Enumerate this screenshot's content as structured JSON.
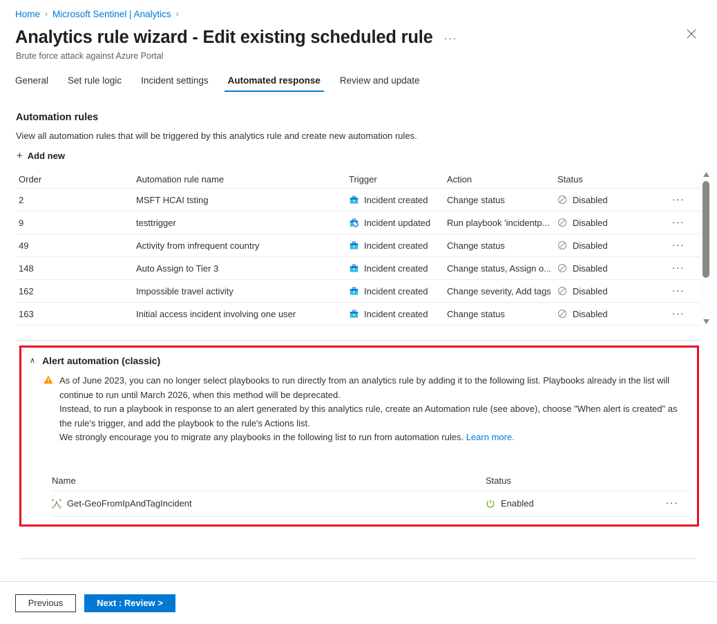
{
  "breadcrumb": {
    "items": [
      {
        "label": "Home"
      },
      {
        "label": "Microsoft Sentinel | Analytics"
      }
    ],
    "separator": "›"
  },
  "header": {
    "title": "Analytics rule wizard - Edit existing scheduled rule",
    "ellipsis": "···",
    "subtitle": "Brute force attack against Azure Portal",
    "close_label": "Close"
  },
  "tabs": [
    {
      "label": "General",
      "active": false
    },
    {
      "label": "Set rule logic",
      "active": false
    },
    {
      "label": "Incident settings",
      "active": false
    },
    {
      "label": "Automated response",
      "active": true
    },
    {
      "label": "Review and update",
      "active": false
    }
  ],
  "automation": {
    "section_title": "Automation rules",
    "section_desc": "View all automation rules that will be triggered by this analytics rule and create new automation rules.",
    "add_new_label": "Add new",
    "add_new_plus": "+",
    "columns": [
      "Order",
      "Automation rule name",
      "Trigger",
      "Action",
      "Status"
    ],
    "rows": [
      {
        "order": "2",
        "name": "MSFT HCAI tsting",
        "trigger": "Incident created",
        "trigger_icon": "incident-created-icon",
        "action": "Change status",
        "status": "Disabled",
        "status_icon": "disabled-icon",
        "more": "···"
      },
      {
        "order": "9",
        "name": "testtrigger",
        "trigger": "Incident updated",
        "trigger_icon": "incident-updated-icon",
        "action": "Run playbook 'incidentp...",
        "status": "Disabled",
        "status_icon": "disabled-icon",
        "more": "···"
      },
      {
        "order": "49",
        "name": "Activity from infrequent country",
        "trigger": "Incident created",
        "trigger_icon": "incident-created-icon",
        "action": "Change status",
        "status": "Disabled",
        "status_icon": "disabled-icon",
        "more": "···"
      },
      {
        "order": "148",
        "name": "Auto Assign to Tier 3",
        "trigger": "Incident created",
        "trigger_icon": "incident-created-icon",
        "action": "Change status, Assign o...",
        "status": "Disabled",
        "status_icon": "disabled-icon",
        "more": "···"
      },
      {
        "order": "162",
        "name": "Impossible travel activity",
        "trigger": "Incident created",
        "trigger_icon": "incident-created-icon",
        "action": "Change severity, Add tags",
        "status": "Disabled",
        "status_icon": "disabled-icon",
        "more": "···"
      },
      {
        "order": "163",
        "name": "Initial access incident involving one user",
        "trigger": "Incident created",
        "trigger_icon": "incident-created-icon",
        "action": "Change status",
        "status": "Disabled",
        "status_icon": "disabled-icon",
        "more": "···"
      }
    ]
  },
  "classic": {
    "chevron": "∧",
    "title": "Alert automation (classic)",
    "warning_p1": "As of June 2023, you can no longer select playbooks to run directly from an analytics rule by adding it to the following list. Playbooks already in the list will continue to run until March 2026, when this method will be deprecated.",
    "warning_p2": "Instead, to run a playbook in response to an alert generated by this analytics rule, create an Automation rule (see above), choose \"When alert is created\" as the rule's trigger, and add the playbook to the rule's Actions list.",
    "warning_p3": "We strongly encourage you to migrate any playbooks in the following list to run from automation rules.",
    "learn_more": "Learn more.",
    "columns": [
      "Name",
      "Status"
    ],
    "rows": [
      {
        "name": "Get-GeoFromIpAndTagIncident",
        "icon": "logic-app-icon",
        "status": "Enabled",
        "status_icon": "enabled-power-icon",
        "more": "···"
      }
    ]
  },
  "footer": {
    "previous_label": "Previous",
    "next_label": "Next : Review >"
  },
  "colors": {
    "accent": "#0078d4",
    "highlight_border": "#e81123",
    "warning": "#ff8c00",
    "enabled": "#57a300",
    "disabled": "#605e5c"
  }
}
